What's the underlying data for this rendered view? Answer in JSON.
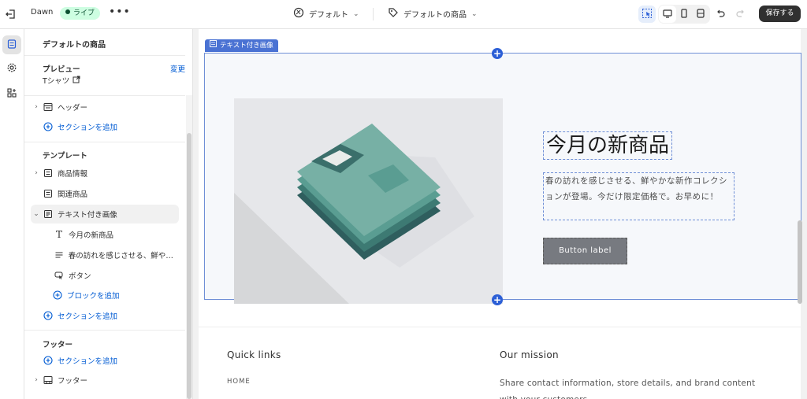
{
  "topbar": {
    "store_name": "Dawn",
    "status_badge": "ライブ",
    "more_label": "•••",
    "theme_label": "デフォルト",
    "template_label": "デフォルトの商品",
    "save_label": "保存する"
  },
  "sidebar": {
    "title": "デフォルトの商品",
    "preview_label": "プレビュー",
    "preview_change": "変更",
    "preview_value": "Tシャツ",
    "header_group": {
      "item": "ヘッダー",
      "add_section": "セクションを追加"
    },
    "template_group": {
      "title": "テンプレート",
      "items": [
        {
          "label": "商品情報"
        },
        {
          "label": "関連商品"
        },
        {
          "label": "テキスト付き画像"
        }
      ],
      "blocks": [
        {
          "label": "今月の新商品"
        },
        {
          "label": "春の訪れを感じさせる、鮮やか..."
        },
        {
          "label": "ボタン"
        }
      ],
      "add_block": "ブロックを追加",
      "add_section": "セクションを追加"
    },
    "footer_group": {
      "title": "フッター",
      "add_section": "セクションを追加",
      "item": "フッター"
    }
  },
  "preview": {
    "section_tag": "テキスト付き画像",
    "heading": "今月の新商品",
    "body": "春の訪れを感じさせる、鮮やかな新作コレクションが登場。今だけ限定価格で。お早めに！",
    "button_label": "Button label",
    "footer": {
      "quick_links_title": "Quick links",
      "quick_links_item": "HOME",
      "mission_title": "Our mission",
      "mission_text": "Share contact information, store details, and brand content with your customers."
    }
  },
  "colors": {
    "accent": "#005bd3",
    "selection": "#4a72d3",
    "live_badge_bg": "#cdfee1",
    "live_badge_fg": "#0c5132",
    "save_button": "#303030"
  }
}
